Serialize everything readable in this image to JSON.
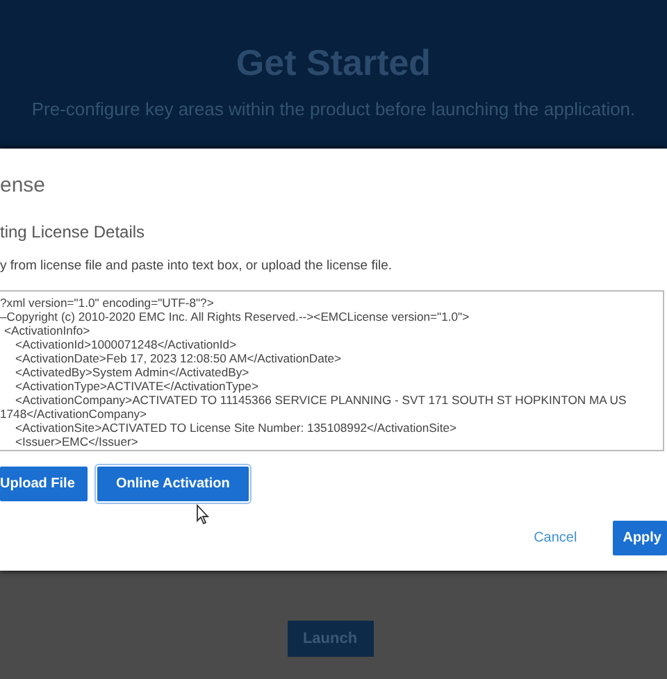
{
  "page": {
    "title": "Get Started",
    "subtitle": "Pre-configure key areas within the product before launching the application.",
    "launch_button": "Launch"
  },
  "dialog": {
    "title": "ense",
    "section_title": "ting License Details",
    "instructions": "y from license file and paste into text box, or upload the license file.",
    "license_text": [
      {
        "text": "?xml version=\"1.0\" encoding=\"UTF-8\"?>"
      },
      {
        "text": "–Copyright (c) 2010-2020 EMC Inc. All Rights Reserved.--><EMCLicense version=\"1.0\">"
      },
      {
        "text": "<ActivationInfo>",
        "children": [
          {
            "text": "<ActivationId>1000071248</ActivationId>"
          },
          {
            "text": "<ActivationDate>Feb 17, 2023 12:08:50 AM</ActivationDate>"
          },
          {
            "text": "<ActivatedBy>System Admin</ActivatedBy>"
          },
          {
            "text": "<ActivationType>ACTIVATE</ActivationType>"
          },
          {
            "text": "<ActivationCompany>ACTIVATED TO 11145366 SERVICE PLANNING - SVT 171 SOUTH ST HOPKINTON MA US 1748</ActivationCompany>"
          },
          {
            "text": "<ActivationSite>ACTIVATED TO License Site Number: 135108992</ActivationSite>"
          },
          {
            "text": "<Issuer>EMC</Issuer>"
          }
        ]
      }
    ],
    "upload_button": "Upload File",
    "online_button": "Online Activation",
    "cancel_button": "Cancel",
    "apply_button": "Apply"
  }
}
